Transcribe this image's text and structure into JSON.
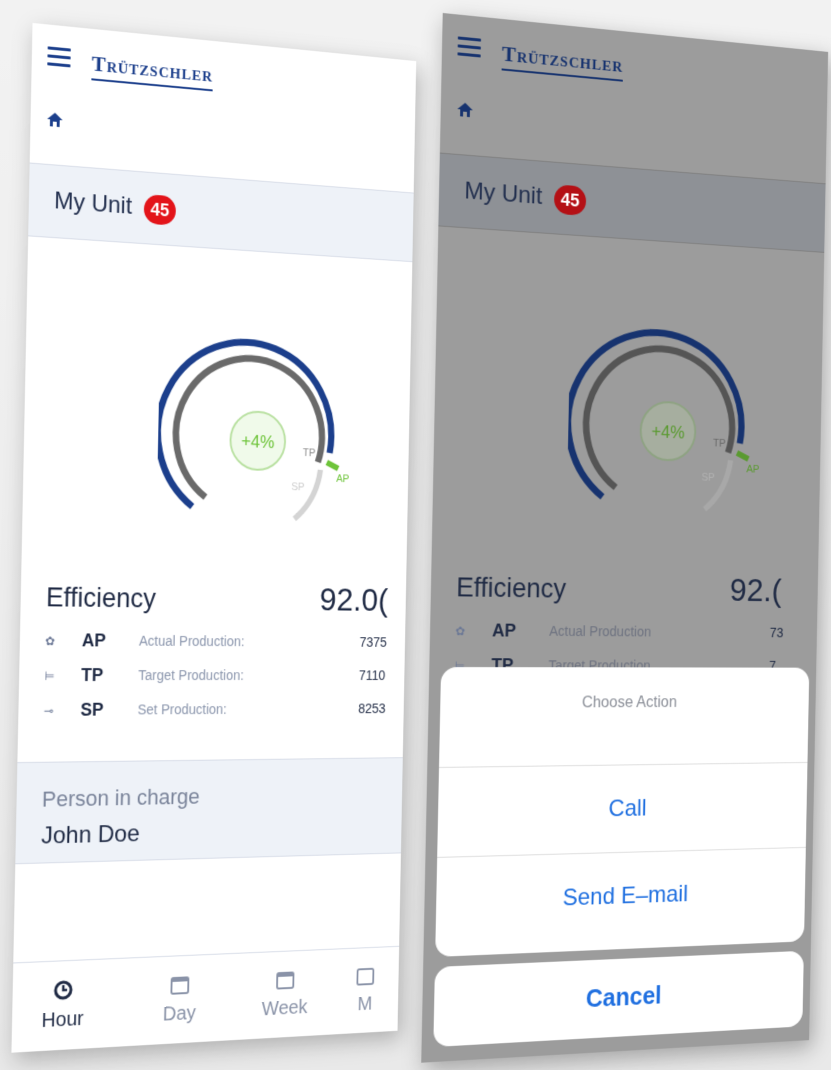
{
  "brand": "Trützschler",
  "unit": {
    "title": "My Unit",
    "badge": "45"
  },
  "gauge": {
    "delta": "+4%",
    "labels": {
      "tp": "TP",
      "sp": "SP",
      "ap": "AP"
    }
  },
  "efficiency": {
    "label": "Efficiency",
    "value": "92.0("
  },
  "metrics": [
    {
      "code": "AP",
      "name": "Actual Production:",
      "value": "7375",
      "icon": "gear-icon"
    },
    {
      "code": "TP",
      "name": "Target Production:",
      "value": "7110",
      "icon": "target-icon"
    },
    {
      "code": "SP",
      "name": "Set Production:",
      "value": "8253",
      "icon": "set-icon"
    }
  ],
  "person": {
    "label": "Person in charge",
    "name": "John Doe"
  },
  "tabs": [
    {
      "label": "Hour",
      "icon": "clock-icon",
      "active": true
    },
    {
      "label": "Day",
      "icon": "calendar-day-icon"
    },
    {
      "label": "Week",
      "icon": "calendar-week-icon"
    },
    {
      "label": "M",
      "icon": "calendar-month-icon"
    }
  ],
  "right": {
    "efficiency_value": "92.(",
    "metrics": [
      {
        "code": "AP",
        "name": "Actual Production",
        "value": "73"
      },
      {
        "code": "TP",
        "name": "Target Production",
        "value": "7"
      }
    ],
    "sheet": {
      "title": "Choose Action",
      "call": "Call",
      "email": "Send E–mail",
      "cancel": "Cancel"
    }
  },
  "colors": {
    "primary": "#1c3f8c",
    "badge": "#e3141a",
    "action": "#1f6fe0",
    "accent_green": "#6ec43a"
  }
}
